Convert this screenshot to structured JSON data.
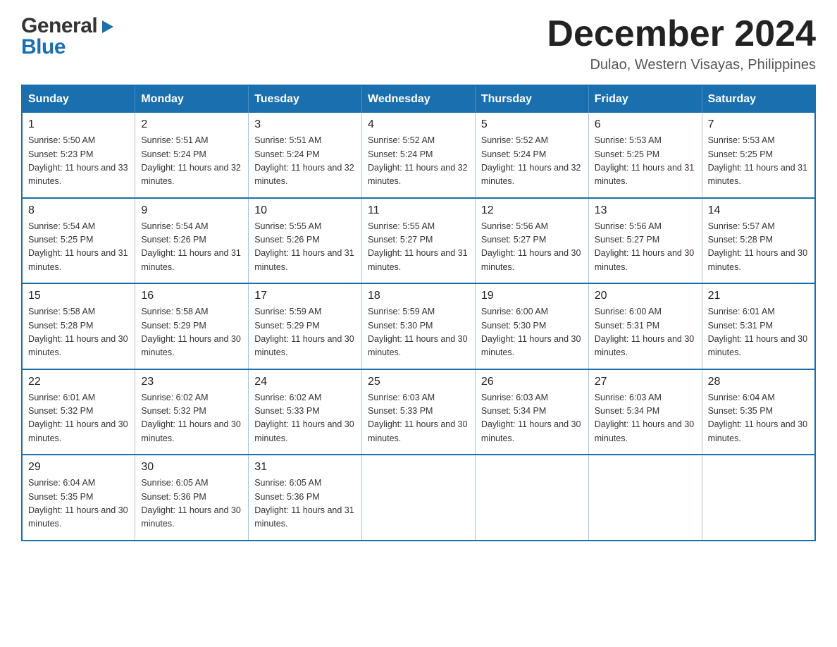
{
  "header": {
    "logo": {
      "general": "General",
      "arrow": "▶",
      "blue": "Blue"
    },
    "title": "December 2024",
    "subtitle": "Dulao, Western Visayas, Philippines"
  },
  "calendar": {
    "days_of_week": [
      "Sunday",
      "Monday",
      "Tuesday",
      "Wednesday",
      "Thursday",
      "Friday",
      "Saturday"
    ],
    "weeks": [
      [
        {
          "day": "1",
          "sunrise": "Sunrise: 5:50 AM",
          "sunset": "Sunset: 5:23 PM",
          "daylight": "Daylight: 11 hours and 33 minutes."
        },
        {
          "day": "2",
          "sunrise": "Sunrise: 5:51 AM",
          "sunset": "Sunset: 5:24 PM",
          "daylight": "Daylight: 11 hours and 32 minutes."
        },
        {
          "day": "3",
          "sunrise": "Sunrise: 5:51 AM",
          "sunset": "Sunset: 5:24 PM",
          "daylight": "Daylight: 11 hours and 32 minutes."
        },
        {
          "day": "4",
          "sunrise": "Sunrise: 5:52 AM",
          "sunset": "Sunset: 5:24 PM",
          "daylight": "Daylight: 11 hours and 32 minutes."
        },
        {
          "day": "5",
          "sunrise": "Sunrise: 5:52 AM",
          "sunset": "Sunset: 5:24 PM",
          "daylight": "Daylight: 11 hours and 32 minutes."
        },
        {
          "day": "6",
          "sunrise": "Sunrise: 5:53 AM",
          "sunset": "Sunset: 5:25 PM",
          "daylight": "Daylight: 11 hours and 31 minutes."
        },
        {
          "day": "7",
          "sunrise": "Sunrise: 5:53 AM",
          "sunset": "Sunset: 5:25 PM",
          "daylight": "Daylight: 11 hours and 31 minutes."
        }
      ],
      [
        {
          "day": "8",
          "sunrise": "Sunrise: 5:54 AM",
          "sunset": "Sunset: 5:25 PM",
          "daylight": "Daylight: 11 hours and 31 minutes."
        },
        {
          "day": "9",
          "sunrise": "Sunrise: 5:54 AM",
          "sunset": "Sunset: 5:26 PM",
          "daylight": "Daylight: 11 hours and 31 minutes."
        },
        {
          "day": "10",
          "sunrise": "Sunrise: 5:55 AM",
          "sunset": "Sunset: 5:26 PM",
          "daylight": "Daylight: 11 hours and 31 minutes."
        },
        {
          "day": "11",
          "sunrise": "Sunrise: 5:55 AM",
          "sunset": "Sunset: 5:27 PM",
          "daylight": "Daylight: 11 hours and 31 minutes."
        },
        {
          "day": "12",
          "sunrise": "Sunrise: 5:56 AM",
          "sunset": "Sunset: 5:27 PM",
          "daylight": "Daylight: 11 hours and 30 minutes."
        },
        {
          "day": "13",
          "sunrise": "Sunrise: 5:56 AM",
          "sunset": "Sunset: 5:27 PM",
          "daylight": "Daylight: 11 hours and 30 minutes."
        },
        {
          "day": "14",
          "sunrise": "Sunrise: 5:57 AM",
          "sunset": "Sunset: 5:28 PM",
          "daylight": "Daylight: 11 hours and 30 minutes."
        }
      ],
      [
        {
          "day": "15",
          "sunrise": "Sunrise: 5:58 AM",
          "sunset": "Sunset: 5:28 PM",
          "daylight": "Daylight: 11 hours and 30 minutes."
        },
        {
          "day": "16",
          "sunrise": "Sunrise: 5:58 AM",
          "sunset": "Sunset: 5:29 PM",
          "daylight": "Daylight: 11 hours and 30 minutes."
        },
        {
          "day": "17",
          "sunrise": "Sunrise: 5:59 AM",
          "sunset": "Sunset: 5:29 PM",
          "daylight": "Daylight: 11 hours and 30 minutes."
        },
        {
          "day": "18",
          "sunrise": "Sunrise: 5:59 AM",
          "sunset": "Sunset: 5:30 PM",
          "daylight": "Daylight: 11 hours and 30 minutes."
        },
        {
          "day": "19",
          "sunrise": "Sunrise: 6:00 AM",
          "sunset": "Sunset: 5:30 PM",
          "daylight": "Daylight: 11 hours and 30 minutes."
        },
        {
          "day": "20",
          "sunrise": "Sunrise: 6:00 AM",
          "sunset": "Sunset: 5:31 PM",
          "daylight": "Daylight: 11 hours and 30 minutes."
        },
        {
          "day": "21",
          "sunrise": "Sunrise: 6:01 AM",
          "sunset": "Sunset: 5:31 PM",
          "daylight": "Daylight: 11 hours and 30 minutes."
        }
      ],
      [
        {
          "day": "22",
          "sunrise": "Sunrise: 6:01 AM",
          "sunset": "Sunset: 5:32 PM",
          "daylight": "Daylight: 11 hours and 30 minutes."
        },
        {
          "day": "23",
          "sunrise": "Sunrise: 6:02 AM",
          "sunset": "Sunset: 5:32 PM",
          "daylight": "Daylight: 11 hours and 30 minutes."
        },
        {
          "day": "24",
          "sunrise": "Sunrise: 6:02 AM",
          "sunset": "Sunset: 5:33 PM",
          "daylight": "Daylight: 11 hours and 30 minutes."
        },
        {
          "day": "25",
          "sunrise": "Sunrise: 6:03 AM",
          "sunset": "Sunset: 5:33 PM",
          "daylight": "Daylight: 11 hours and 30 minutes."
        },
        {
          "day": "26",
          "sunrise": "Sunrise: 6:03 AM",
          "sunset": "Sunset: 5:34 PM",
          "daylight": "Daylight: 11 hours and 30 minutes."
        },
        {
          "day": "27",
          "sunrise": "Sunrise: 6:03 AM",
          "sunset": "Sunset: 5:34 PM",
          "daylight": "Daylight: 11 hours and 30 minutes."
        },
        {
          "day": "28",
          "sunrise": "Sunrise: 6:04 AM",
          "sunset": "Sunset: 5:35 PM",
          "daylight": "Daylight: 11 hours and 30 minutes."
        }
      ],
      [
        {
          "day": "29",
          "sunrise": "Sunrise: 6:04 AM",
          "sunset": "Sunset: 5:35 PM",
          "daylight": "Daylight: 11 hours and 30 minutes."
        },
        {
          "day": "30",
          "sunrise": "Sunrise: 6:05 AM",
          "sunset": "Sunset: 5:36 PM",
          "daylight": "Daylight: 11 hours and 30 minutes."
        },
        {
          "day": "31",
          "sunrise": "Sunrise: 6:05 AM",
          "sunset": "Sunset: 5:36 PM",
          "daylight": "Daylight: 11 hours and 31 minutes."
        },
        null,
        null,
        null,
        null
      ]
    ]
  }
}
